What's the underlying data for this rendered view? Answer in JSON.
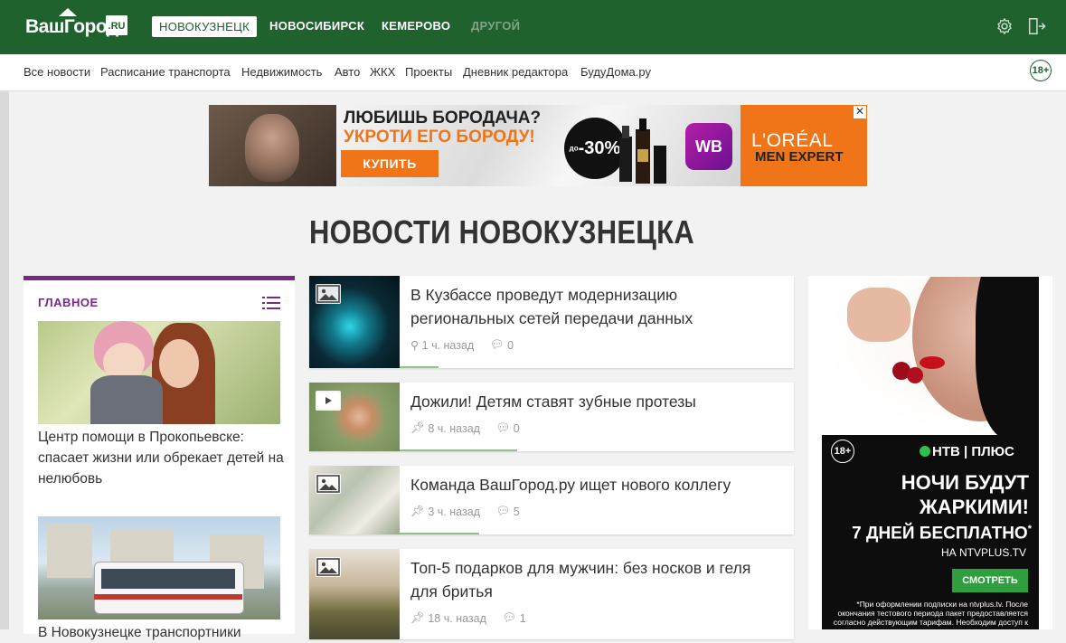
{
  "header": {
    "logo_text": "ВашГород",
    "logo_suffix": ".RU",
    "cities": [
      {
        "label": "НОВОКУЗНЕЦК",
        "active": true
      },
      {
        "label": "НОВОСИБИРСК",
        "active": false
      },
      {
        "label": "КЕМЕРОВО",
        "active": false
      },
      {
        "label": "ДРУГОЙ",
        "active": false
      }
    ],
    "icons": [
      "gear-icon",
      "logout-icon"
    ],
    "color": "#20622e"
  },
  "subnav": {
    "items": [
      "Все новости",
      "Расписание транспорта",
      "Недвижимость",
      "Авто",
      "ЖКХ",
      "Проекты",
      "Дневник редактора",
      "БудуДома.ру"
    ],
    "age_badge": "18+"
  },
  "banner": {
    "line1": "ЛЮБИШЬ БОРОДАЧА?",
    "line2": "УКРОТИ ЕГО БОРОДУ!",
    "button": "КУПИТЬ",
    "discount": "-30%",
    "discount_prefix": "до",
    "wb": "WB",
    "brand": "L'ORÉAL",
    "brand_sub": "MEN EXPERT",
    "close": "✕"
  },
  "page_title": "НОВОСТИ НОВОКУЗНЕЦКА",
  "main_column": {
    "heading": "ГЛАВНОЕ",
    "accent": "#762a83",
    "items": [
      {
        "title": "Центр помощи в Прокопьевске: спасает жизни или обрекает детей на нелюбовь"
      },
      {
        "title": "В Новокузнецке транспортники"
      }
    ]
  },
  "news": [
    {
      "title": "В Кузбассе проведут модернизацию региональных сетей передачи данных",
      "time": "1 ч. назад",
      "comments": "0",
      "media": "image-icon"
    },
    {
      "title": "Дожили! Детям ставят зубные протезы",
      "time": "8 ч. назад",
      "comments": "0",
      "media": "video-icon"
    },
    {
      "title": "Команда ВашГород.ру ищет нового коллегу",
      "time": "3 ч. назад",
      "comments": "5",
      "media": "image-icon"
    },
    {
      "title": "Топ-5 подарков для мужчин: без носков и геля для бритья",
      "time": "18 ч. назад",
      "comments": "1",
      "media": "image-icon"
    }
  ],
  "side_ad": {
    "age": "18+",
    "brand": "НТВ",
    "brand_plus": "ПЛЮС",
    "headline_1": "НОЧИ БУДУТ",
    "headline_2": "ЖАРКИМИ!",
    "offer": "7 ДНЕЙ БЕСПЛАТНО",
    "offer_mark": "*",
    "site": "НА NTVPLUS.TV",
    "button": "СМОТРЕТЬ",
    "fine_print": "*При оформлении подписки на ntvplus.tv. После окончания тестового периода пакет предоставляется согласно действующим тарифам. Необходим доступ к сети интернет"
  }
}
